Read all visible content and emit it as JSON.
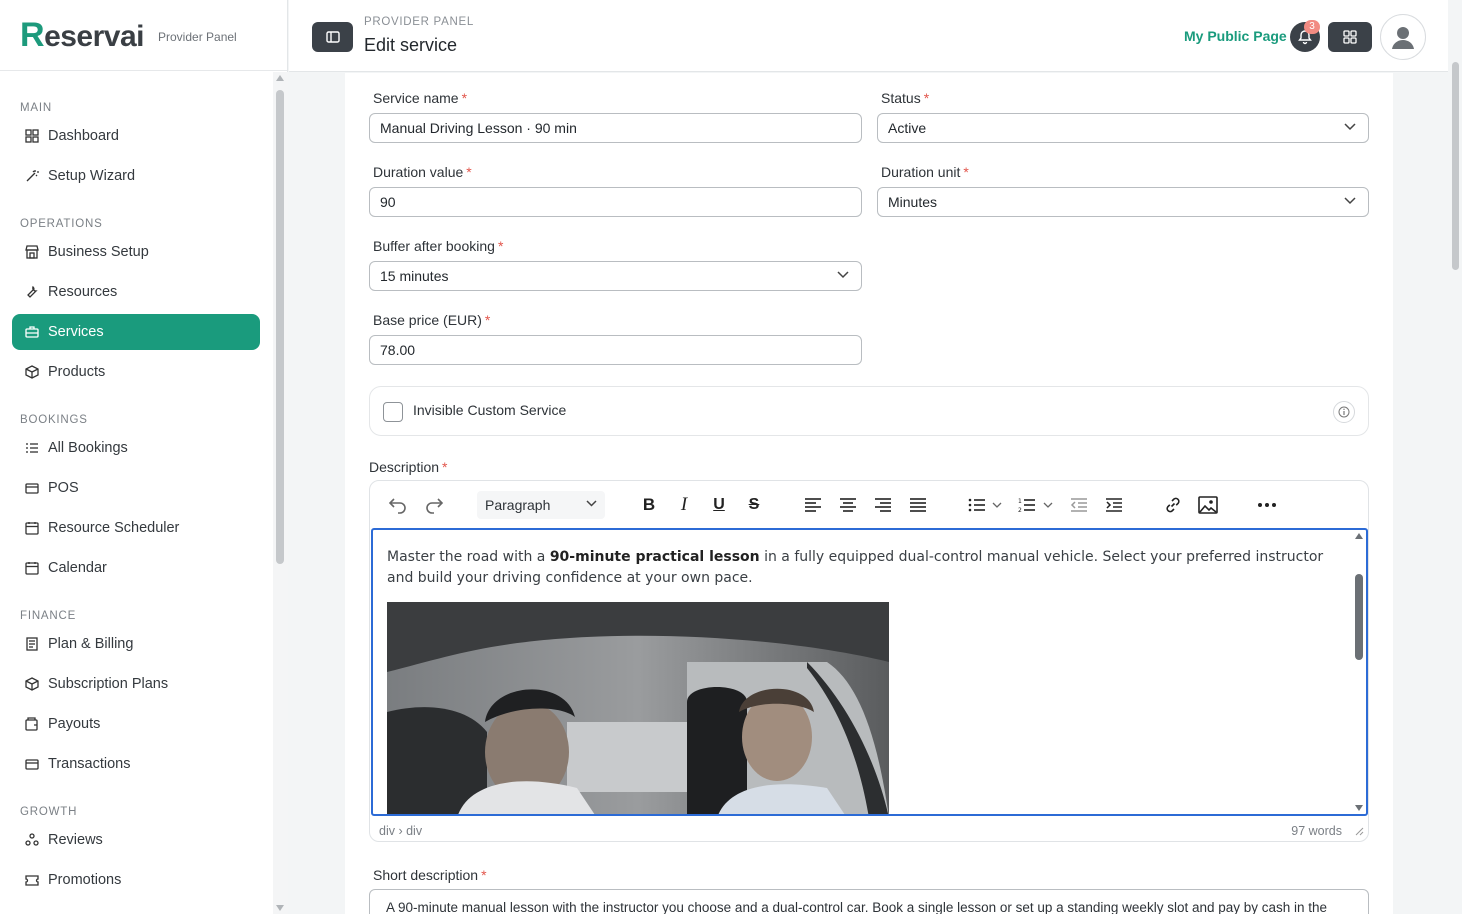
{
  "brand": {
    "logo_first": "R",
    "logo_rest": "eservai",
    "subtitle": "Provider Panel"
  },
  "header": {
    "section": "PROVIDER PANEL",
    "title": "Edit service",
    "public_link": "My Public Page",
    "notification_count": "3"
  },
  "sidebar": {
    "sections": [
      {
        "title": "MAIN",
        "items": [
          {
            "label": "Dashboard",
            "icon": "grid-icon"
          },
          {
            "label": "Setup Wizard",
            "icon": "wand-icon"
          }
        ]
      },
      {
        "title": "OPERATIONS",
        "items": [
          {
            "label": "Business Setup",
            "icon": "store-icon"
          },
          {
            "label": "Resources",
            "icon": "wrench-icon"
          },
          {
            "label": "Services",
            "icon": "briefcase-icon",
            "active": true
          },
          {
            "label": "Products",
            "icon": "box-icon"
          }
        ]
      },
      {
        "title": "BOOKINGS",
        "items": [
          {
            "label": "All Bookings",
            "icon": "list-icon"
          },
          {
            "label": "POS",
            "icon": "card-icon"
          },
          {
            "label": "Resource Scheduler",
            "icon": "calendar-icon"
          },
          {
            "label": "Calendar",
            "icon": "calendar-icon"
          }
        ]
      },
      {
        "title": "FINANCE",
        "items": [
          {
            "label": "Plan & Billing",
            "icon": "receipt-icon"
          },
          {
            "label": "Subscription Plans",
            "icon": "box-icon"
          },
          {
            "label": "Payouts",
            "icon": "wallet-icon"
          },
          {
            "label": "Transactions",
            "icon": "card-icon"
          }
        ]
      },
      {
        "title": "GROWTH",
        "items": [
          {
            "label": "Reviews",
            "icon": "people-icon"
          },
          {
            "label": "Promotions",
            "icon": "ticket-icon"
          }
        ]
      }
    ]
  },
  "form": {
    "service_name": {
      "label": "Service name",
      "value": "Manual Driving Lesson · 90 min"
    },
    "status": {
      "label": "Status",
      "value": "Active"
    },
    "duration_value": {
      "label": "Duration value",
      "value": "90"
    },
    "duration_unit": {
      "label": "Duration unit",
      "value": "Minutes"
    },
    "buffer": {
      "label": "Buffer after booking",
      "value": "15 minutes"
    },
    "base_price": {
      "label": "Base price (EUR)",
      "value": "78.00"
    },
    "invisible": {
      "label": "Invisible Custom Service",
      "checked": false
    },
    "description": {
      "label": "Description",
      "block_format": "Paragraph",
      "text_before": "Master the road with a ",
      "text_bold": "90-minute practical lesson",
      "text_after": " in a fully equipped dual-control manual vehicle. Select your preferred instructor and build your driving confidence at your own pace.",
      "path": "div › div",
      "word_count": "97 words"
    },
    "short_description": {
      "label": "Short description",
      "value": "A 90-minute manual lesson with the instructor you choose and a dual-control car. Book a single lesson or set up a standing weekly slot and pay by cash in the"
    }
  },
  "colors": {
    "accent": "#1a9b7d",
    "dark": "#3b4148",
    "focus": "#2c6bd6",
    "required": "#e2554b"
  }
}
